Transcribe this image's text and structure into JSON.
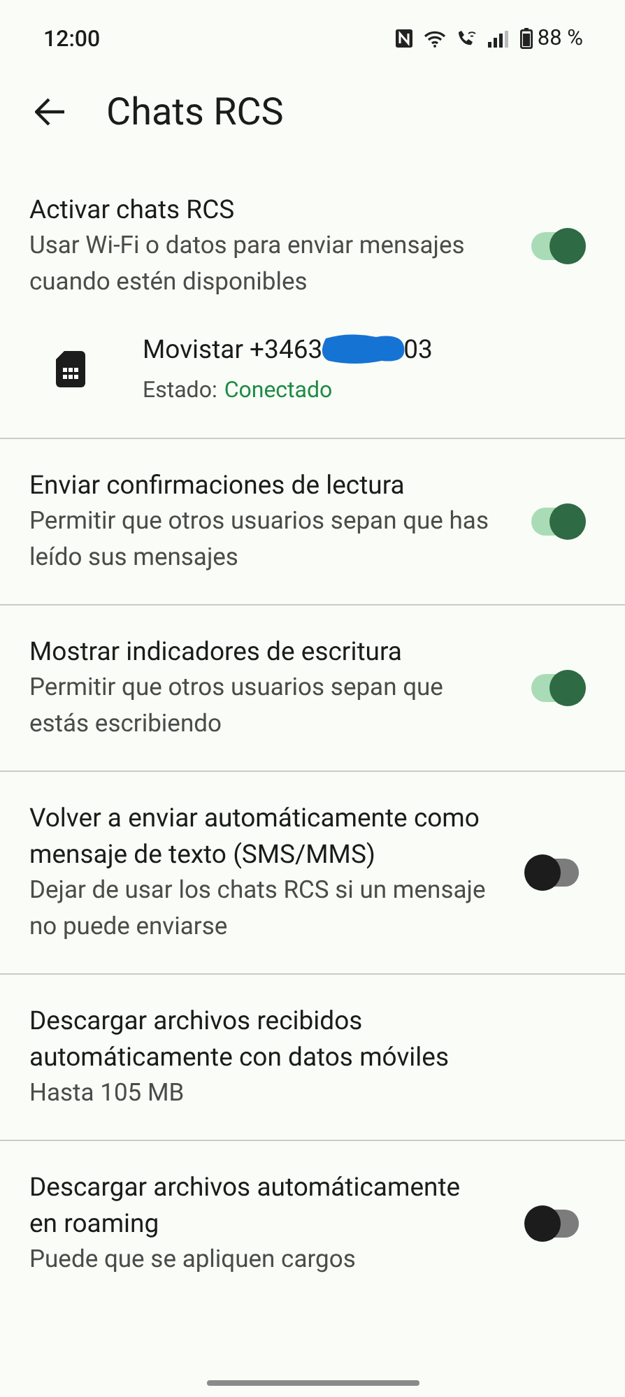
{
  "status_bar": {
    "time": "12:00",
    "battery": "88 %"
  },
  "header": {
    "title": "Chats RCS"
  },
  "sections": [
    {
      "items": [
        {
          "kind": "toggle",
          "title": "Activar chats RCS",
          "subtitle": "Usar Wi-Fi o datos para enviar mensajes cuando estén disponibles",
          "on": true
        },
        {
          "kind": "sim",
          "name_start": "Movistar +3463",
          "name_end": "03",
          "status_label": "Estado:",
          "status": "Conectado",
          "color": "#1e8a44"
        }
      ]
    },
    {
      "items": [
        {
          "kind": "toggle",
          "title": "Enviar confirmaciones de lectura",
          "subtitle": "Permitir que otros usuarios sepan que has leído sus mensajes",
          "on": true
        }
      ]
    },
    {
      "items": [
        {
          "kind": "toggle",
          "title": "Mostrar indicadores de escritura",
          "subtitle": "Permitir que otros usuarios sepan que estás escribiendo",
          "on": true
        }
      ]
    },
    {
      "items": [
        {
          "kind": "toggle",
          "title": "Volver a enviar automáticamente como mensaje de texto (SMS/MMS)",
          "subtitle": "Dejar de usar los chats RCS si un mensaje no puede enviarse",
          "on": false
        }
      ]
    },
    {
      "items": [
        {
          "kind": "info",
          "title": "Descargar archivos recibidos automáticamente con datos móviles",
          "subtitle": "Hasta 105 MB"
        }
      ]
    },
    {
      "items": [
        {
          "kind": "toggle",
          "title": "Descargar archivos automáticamente en roaming",
          "subtitle": "Puede que se apliquen cargos",
          "on": false
        }
      ]
    }
  ]
}
